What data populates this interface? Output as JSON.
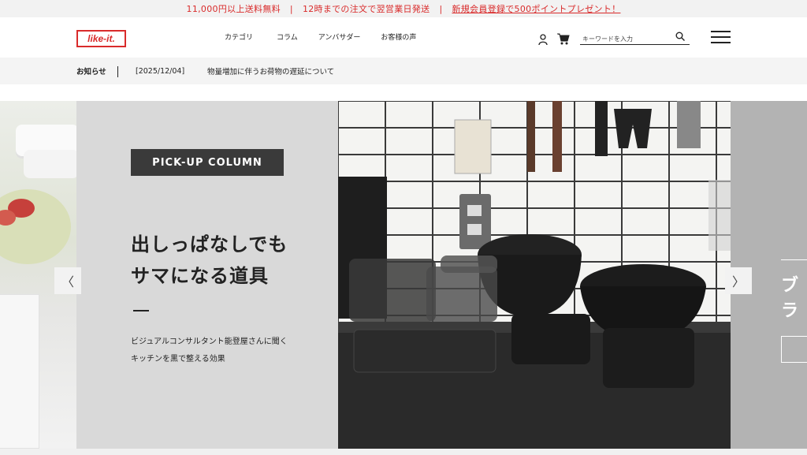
{
  "announcement": {
    "items": [
      "11,000円以上送料無料",
      "12時までの注文で翌営業日発送",
      "新規会員登録で500ポイントプレゼント！"
    ],
    "separator": "|",
    "color": "#d92b2b"
  },
  "header": {
    "logo_text": "like-it.",
    "nav": [
      "カテゴリ",
      "コラム",
      "アンバサダー",
      "お客様の声"
    ],
    "search_placeholder": "キーワードを入力",
    "icons": [
      "user-icon",
      "cart-icon",
      "search-icon",
      "menu-icon"
    ]
  },
  "news": {
    "label": "お知らせ",
    "date": "[2025/12/04]",
    "text": "物量増加に伴うお荷物の遅延について"
  },
  "hero": {
    "badge": "PICK-UP COLUMN",
    "headline_line1": "出しっぱなしでも",
    "headline_line2": "サマになる道具",
    "desc_line1": "ビジュアルコンサルタント能登屋さんに聞く",
    "desc_line2": "キッチンを黒で整える効果",
    "next_slide_partial_text": "ブラ",
    "prev_arrow": "〈",
    "next_arrow": "〉"
  }
}
